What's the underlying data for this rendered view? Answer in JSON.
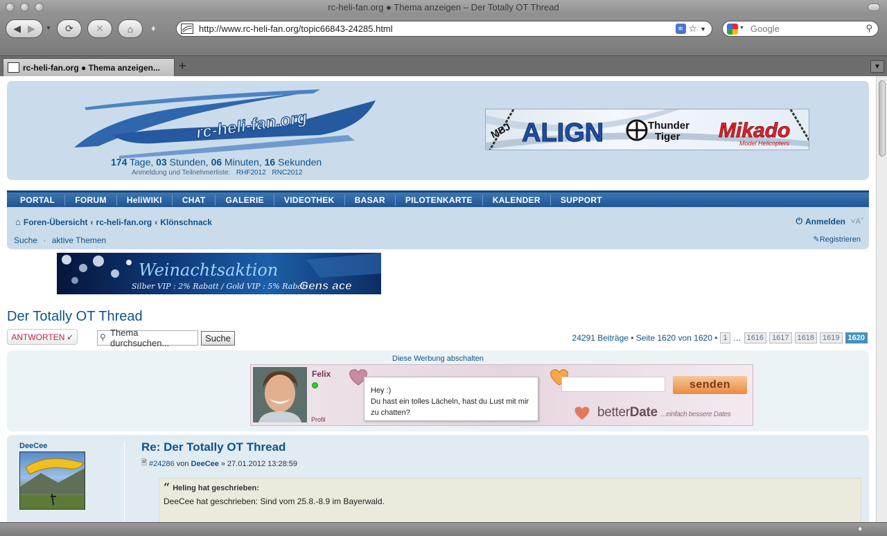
{
  "window": {
    "title": "rc-heli-fan.org ● Thema anzeigen – Der Totally OT Thread"
  },
  "toolbar": {
    "url": "http://www.rc-heli-fan.org/topic66843-24285.html",
    "search_placeholder": "Google"
  },
  "tabs": [
    {
      "label": "rc-heli-fan.org ● Thema anzeigen..."
    }
  ],
  "header": {
    "logo_text": "rc-heli-fan.org",
    "countdown": {
      "days": "174",
      "days_label": "Tage,",
      "hours": "03",
      "hours_label": "Stunden,",
      "minutes": "06",
      "minutes_label": "Minuten,",
      "seconds": "16",
      "seconds_label": "Sekunden"
    },
    "registration_label": "Anmeldung und Teilnehmerliste:",
    "registration_links": [
      "RHF2012",
      "RNC2012"
    ],
    "sponsor_banner": {
      "brands": [
        "MBJ",
        "ALIGN",
        "Thunder",
        "Tiger",
        "Mikado",
        "Model Helicopters"
      ]
    }
  },
  "nav": {
    "items": [
      "PORTAL",
      "FORUM",
      "HeliWIKI",
      "CHAT",
      "GALERIE",
      "VIDEOTHEK",
      "BASAR",
      "PILOTENKARTE",
      "KALENDER",
      "SUPPORT"
    ]
  },
  "breadcrumb": {
    "items": [
      "Foren-Übersicht",
      "rc-heli-fan.org",
      "Klönschnack"
    ],
    "separator": "‹"
  },
  "userbar": {
    "login_label": "Anmelden",
    "register_label": "Registrieren",
    "quicklinks": [
      "Suche",
      "aktive Themen"
    ],
    "quicklinks_separator": "·"
  },
  "promo_banner": {
    "headline": "Weinachtsaktion",
    "subline": "Silber VIP : 2% Rabatt / Gold VIP : 5% Rabatt",
    "brand": "Gens ace"
  },
  "topic": {
    "title": "Der Totally OT Thread",
    "reply_label": "ANTWORTEN",
    "search_value": "Thema durchsuchen...",
    "search_button": "Suche",
    "pagination": {
      "summary": "24291 Beiträge • Seite 1620 von 1620 •",
      "first_page": "1",
      "ellipsis": "…",
      "pages": [
        "1616",
        "1617",
        "1618",
        "1619"
      ],
      "current_page": "1620"
    }
  },
  "ad": {
    "disable_label": "Diese Werbung abschalten",
    "name": "Felix",
    "profile_label": "Profil",
    "message_line1": "Hey :)",
    "message_line2": "Du hast ein tolles Lächeln, hast du Lust mit mir zu chatten?",
    "send_label": "senden",
    "brand_a": "better",
    "brand_b": "Date",
    "tagline": "...einfach bessere Dates"
  },
  "post": {
    "author": "DeeCee",
    "title": "Re: Der Totally OT Thread",
    "number": "#24286",
    "by_label": "von",
    "date": "» 27.01.2012 13:28:59",
    "quote_author": "Heling hat geschrieben:",
    "quote_text": "DeeCee hat geschrieben: Sind vom 25.8.-8.9 im Bayerwald."
  },
  "colors": {
    "forum_blue": "#105289",
    "header_bg": "#cadceb",
    "nav_bg": "#1e5693",
    "post_bg": "#e1ebf2",
    "reply_red": "#bc2a4d",
    "page_current": "#4692bf"
  }
}
